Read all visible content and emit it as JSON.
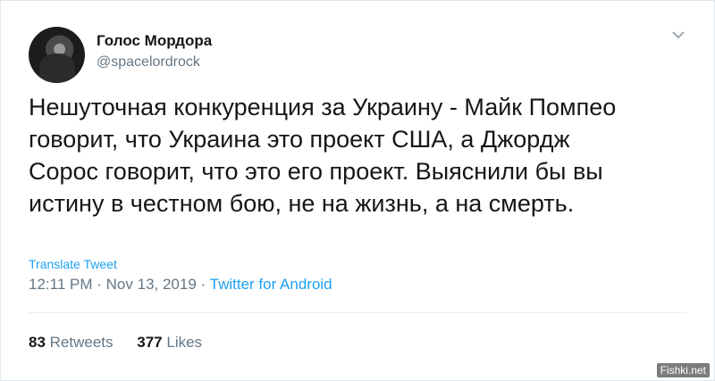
{
  "author": {
    "name": "Голос Мордора",
    "handle": "@spacelordrock"
  },
  "tweet": {
    "lines": [
      "Нешуточная конкуренция за Украину - Майк Помпео",
      "говорит, что Украина это проект США, а Джордж",
      "Сорос говорит, что это его проект. Выяснили бы вы",
      "истину в честном бою, не на жизнь, а на смерть."
    ],
    "translate_label": "Translate Tweet",
    "time": "12:11 PM",
    "date": "Nov 13, 2019",
    "separator": "·",
    "source": "Twitter for Android"
  },
  "stats": {
    "retweets_count": "83",
    "retweets_label": "Retweets",
    "likes_count": "377",
    "likes_label": "Likes"
  },
  "watermark": "Fishki.net",
  "colors": {
    "link": "#1da1f2",
    "secondary_text": "#657786",
    "primary_text": "#14171a"
  }
}
